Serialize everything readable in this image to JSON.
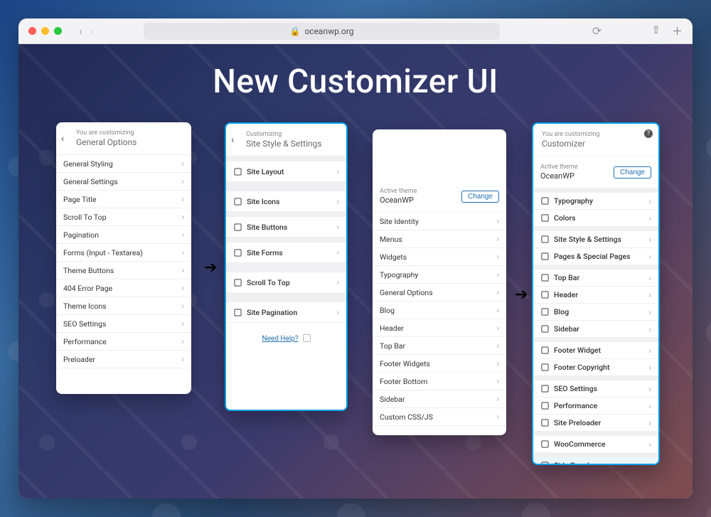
{
  "url": "oceanwp.org",
  "headline": "New Customizer UI",
  "panelA": {
    "eyebrow": "You are customizing",
    "title": "General Options",
    "items": [
      "General Styling",
      "General Settings",
      "Page Title",
      "Scroll To Top",
      "Pagination",
      "Forms (Input - Textarea)",
      "Theme Buttons",
      "404 Error Page",
      "Theme Icons",
      "SEO Settings",
      "Performance",
      "Preloader"
    ]
  },
  "panelB": {
    "eyebrow": "Customizing",
    "title": "Site Style & Settings",
    "items": [
      "Site Layout",
      "Site Icons",
      "Site Buttons",
      "Site Forms",
      "Scroll To Top",
      "Site Pagination"
    ],
    "help": "Need Help?"
  },
  "panelC": {
    "themeLabel": "Active theme",
    "themeName": "OceanWP",
    "change": "Change",
    "items": [
      "Site Identity",
      "Menus",
      "Widgets",
      "Typography",
      "General Options",
      "Blog",
      "Header",
      "Top Bar",
      "Footer Widgets",
      "Footer Bottom",
      "Sidebar",
      "Custom CSS/JS"
    ]
  },
  "panelD": {
    "eyebrow": "You are customizing",
    "title": "Customizer",
    "themeLabel": "Active theme",
    "themeName": "OceanWP",
    "change": "Change",
    "groups": [
      [
        "Typography",
        "Colors"
      ],
      [
        "Site Style & Settings",
        "Pages & Special Pages"
      ],
      [
        "Top Bar",
        "Header",
        "Blog",
        "Sidebar"
      ],
      [
        "Footer Widget",
        "Footer Copyright"
      ],
      [
        "SEO Settings",
        "Performance",
        "Site Preloader"
      ],
      [
        "WooCommerce"
      ],
      [
        "Side Panel"
      ]
    ]
  }
}
